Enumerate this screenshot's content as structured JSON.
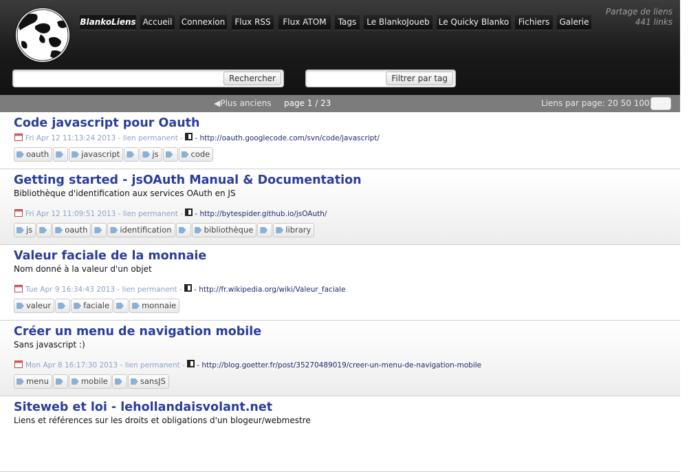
{
  "header": {
    "brand": "BlankoLiens",
    "nav": [
      "Accueil",
      "Connexion",
      "Flux RSS",
      "Flux ATOM",
      "Tags",
      "Le BlankoJoueb",
      "Le Quicky Blanko",
      "Fichiers",
      "Galerie"
    ],
    "tagline_1": "Partage de liens",
    "tagline_2": "441 links",
    "search_button": "Rechercher",
    "tag_filter_button": "Filtrer par tag"
  },
  "pager": {
    "older": "◀Plus anciens",
    "page_info": "page 1 / 23",
    "per_page": "Liens par page: 20 50 100"
  },
  "links": [
    {
      "title": "Code javascript pour Oauth",
      "description": "",
      "date": "Fri Apr 12 11:13:24 2013",
      "permalink": "lien permanent",
      "url": "http://oauth.googlecode.com/svn/code/javascript/",
      "tags": [
        "oauth",
        "javascript",
        "js",
        "code"
      ]
    },
    {
      "title": "Getting started - jsOAuth Manual & Documentation",
      "description": "Bibliothèque d'identification aux services OAuth en JS",
      "date": "Fri Apr 12 11:09:51 2013",
      "permalink": "lien permanent",
      "url": "http://bytespider.github.io/jsOAuth/",
      "tags": [
        "js",
        "oauth",
        "identification",
        "bibliothèque",
        "library"
      ]
    },
    {
      "title": "Valeur faciale de la monnaie",
      "description": "Nom donné à la valeur d'un objet",
      "date": "Tue Apr 9 16:34:43 2013",
      "permalink": "lien permanent",
      "url": "http://fr.wikipedia.org/wiki/Valeur_faciale",
      "tags": [
        "valeur",
        "faciale",
        "monnaie"
      ]
    },
    {
      "title": "Créer un menu de navigation mobile",
      "description": "Sans javascript :)",
      "date": "Mon Apr 8 16:17:30 2013",
      "permalink": "lien permanent",
      "url": "http://blog.goetter.fr/post/35270489019/creer-un-menu-de-navigation-mobile",
      "tags": [
        "menu",
        "mobile",
        "sansJS"
      ]
    },
    {
      "title": "Siteweb et loi - lehollandaisvolant.net",
      "description": "Liens et références sur les droits et obligations d'un blogeur/webmestre",
      "date": "",
      "permalink": "",
      "url": "",
      "tags": []
    }
  ],
  "icons": {
    "logo": "globe-icon",
    "date": "calendar-icon",
    "qrcode": "qrcode-icon",
    "tag": "tag-icon"
  },
  "colors": {
    "title": "#2a3d9c",
    "meta": "#8aa3c4",
    "url": "#1e2a6e",
    "pager_bg": "#7c7c7c",
    "header_bg": "#1a1a1a"
  }
}
